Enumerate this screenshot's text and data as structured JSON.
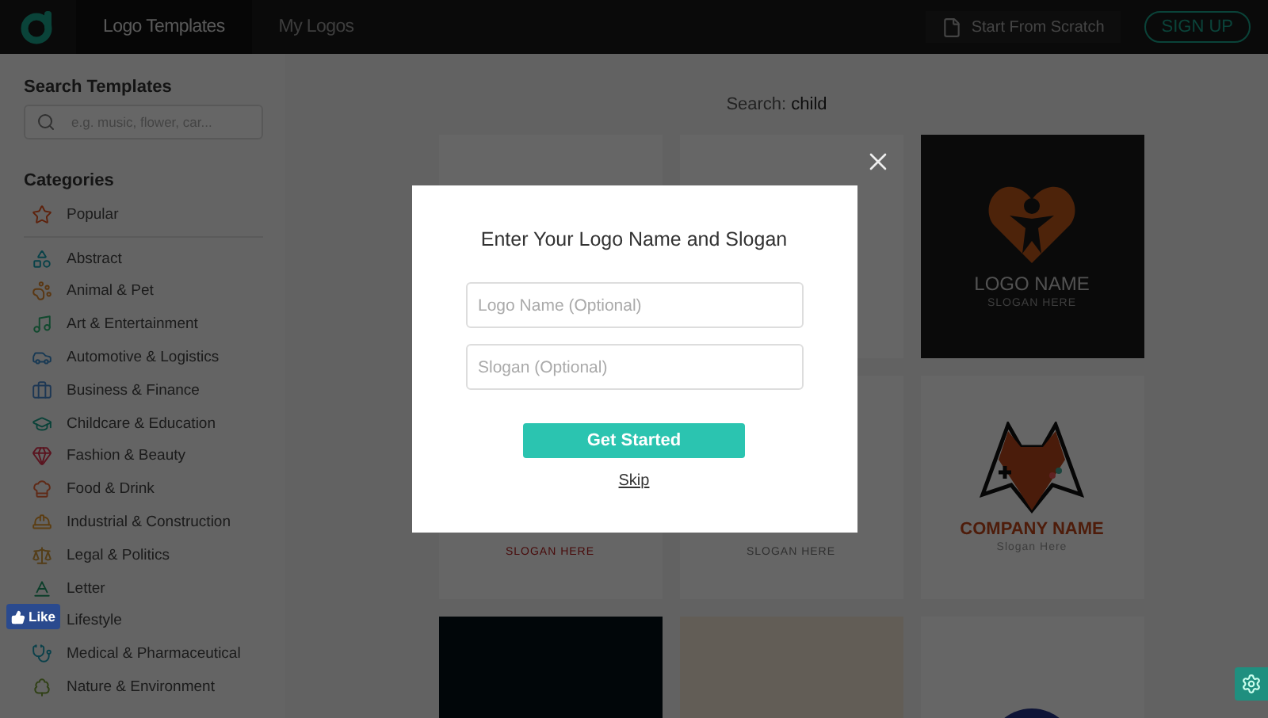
{
  "header": {
    "tabs": [
      {
        "label": "Logo Templates",
        "selected": true
      },
      {
        "label": "My Logos",
        "selected": false
      }
    ],
    "scratch_button": "Start From Scratch",
    "signup_button": "SIGN UP"
  },
  "sidebar": {
    "search_title": "Search Templates",
    "search": {
      "placeholder": "e.g. music, flower, car..."
    },
    "categories_title": "Categories",
    "categories": [
      {
        "label": "Popular"
      },
      {
        "label": "Abstract"
      },
      {
        "label": "Animal & Pet"
      },
      {
        "label": "Art & Entertainment"
      },
      {
        "label": "Automotive & Logistics"
      },
      {
        "label": "Business & Finance"
      },
      {
        "label": "Childcare & Education"
      },
      {
        "label": "Fashion & Beauty"
      },
      {
        "label": "Food & Drink"
      },
      {
        "label": "Industrial & Construction"
      },
      {
        "label": "Legal & Politics"
      },
      {
        "label": "Letter"
      },
      {
        "label": "Lifestyle"
      },
      {
        "label": "Medical & Pharmaceutical"
      },
      {
        "label": "Nature & Environment"
      }
    ]
  },
  "like_button": "Like",
  "search_label": "Search:",
  "search_term": "child",
  "tiles": [
    {
      "kind": "plain"
    },
    {
      "kind": "plain"
    },
    {
      "kind": "heart",
      "name": "LOGO NAME",
      "slogan": "SLOGAN HERE"
    },
    {
      "kind": "slogan-red",
      "slogan": "SLOGAN HERE"
    },
    {
      "kind": "slogan-grey",
      "slogan": "SLOGAN HERE"
    },
    {
      "kind": "fox",
      "name": "COMPANY NAME",
      "slogan": "Slogan Here"
    },
    {
      "kind": "dark"
    },
    {
      "kind": "tan"
    },
    {
      "kind": "badge"
    }
  ],
  "modal": {
    "title": "Enter Your Logo Name and Slogan",
    "fields": [
      {
        "placeholder": "Logo Name (Optional)"
      },
      {
        "placeholder": "Slogan (Optional)"
      }
    ],
    "primary_button": "Get Started",
    "skip_link": "Skip"
  }
}
